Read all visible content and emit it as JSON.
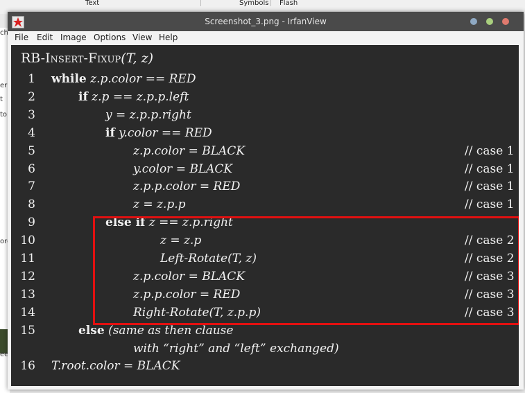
{
  "background": {
    "tabs": [
      "Text",
      "Symbols",
      "Flash"
    ],
    "left_fragments": [
      "ch",
      "er",
      "t",
      "to",
      "orc",
      "ee"
    ]
  },
  "window": {
    "title": "Screenshot_3.png - IrfanView",
    "menu": [
      "File",
      "Edit",
      "Image",
      "Options",
      "View",
      "Help"
    ]
  },
  "algorithm": {
    "title_name": "RB-Insert-Fixup",
    "title_args": "(T, z)",
    "lines": [
      {
        "num": "1",
        "indent": 0,
        "kw": "while",
        "code": " z.p.color == RED",
        "comment": ""
      },
      {
        "num": "2",
        "indent": 1,
        "kw": "if",
        "code": " z.p == z.p.p.left",
        "comment": ""
      },
      {
        "num": "3",
        "indent": 2,
        "kw": "",
        "code": "y = z.p.p.right",
        "comment": ""
      },
      {
        "num": "4",
        "indent": 2,
        "kw": "if",
        "code": " y.color == RED",
        "comment": ""
      },
      {
        "num": "5",
        "indent": 3,
        "kw": "",
        "code": "z.p.color = BLACK",
        "comment": "// case 1"
      },
      {
        "num": "6",
        "indent": 3,
        "kw": "",
        "code": "y.color = BLACK",
        "comment": "// case 1"
      },
      {
        "num": "7",
        "indent": 3,
        "kw": "",
        "code": "z.p.p.color = RED",
        "comment": "// case 1"
      },
      {
        "num": "8",
        "indent": 3,
        "kw": "",
        "code": "z = z.p.p",
        "comment": "// case 1"
      },
      {
        "num": "9",
        "indent": 2,
        "kw": "else if",
        "code": " z == z.p.right",
        "comment": ""
      },
      {
        "num": "10",
        "indent": 4,
        "kw": "",
        "code": "z = z.p",
        "comment": "// case 2"
      },
      {
        "num": "11",
        "indent": 4,
        "kw": "",
        "code": "Left-Rotate(T, z)",
        "comment": "// case 2"
      },
      {
        "num": "12",
        "indent": 3,
        "kw": "",
        "code": "z.p.color = BLACK",
        "comment": "// case 3"
      },
      {
        "num": "13",
        "indent": 3,
        "kw": "",
        "code": "z.p.p.color = RED",
        "comment": "// case 3"
      },
      {
        "num": "14",
        "indent": 3,
        "kw": "",
        "code": "Right-Rotate(T, z.p.p)",
        "comment": "// case 3"
      },
      {
        "num": "15",
        "indent": 1,
        "kw": "else",
        "code": " (same as then clause",
        "comment": ""
      },
      {
        "num": "",
        "indent": 3,
        "kw": "",
        "code": "with “right” and “left” exchanged)",
        "comment": ""
      },
      {
        "num": "16",
        "indent": 0,
        "kw": "",
        "code": "T.root.color = BLACK",
        "comment": ""
      }
    ]
  },
  "colors": {
    "highlight": "#e21010",
    "content_bg": "#2a2a2a"
  }
}
